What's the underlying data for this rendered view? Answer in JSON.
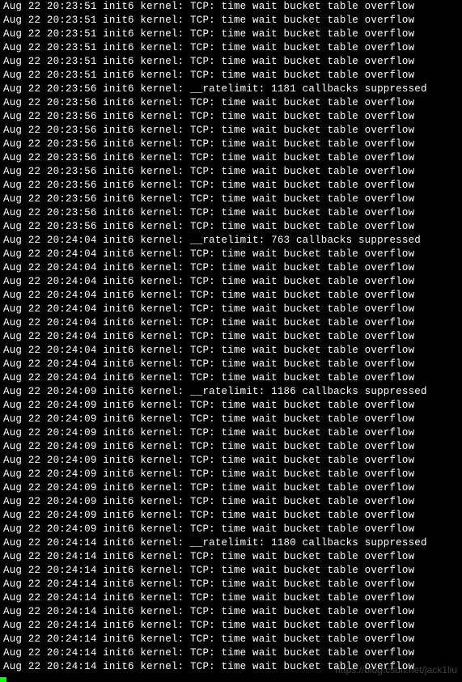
{
  "terminal": {
    "host": "init6",
    "facility": "kernel",
    "tcp_msg": "TCP: time wait bucket table overflow",
    "ratelimit_prefix": "__ratelimit:",
    "ratelimit_suffix": "callbacks suppressed",
    "lines": [
      {
        "date": "Aug 22",
        "time": "20:23:51",
        "type": "tcp"
      },
      {
        "date": "Aug 22",
        "time": "20:23:51",
        "type": "tcp"
      },
      {
        "date": "Aug 22",
        "time": "20:23:51",
        "type": "tcp"
      },
      {
        "date": "Aug 22",
        "time": "20:23:51",
        "type": "tcp"
      },
      {
        "date": "Aug 22",
        "time": "20:23:51",
        "type": "tcp"
      },
      {
        "date": "Aug 22",
        "time": "20:23:51",
        "type": "tcp"
      },
      {
        "date": "Aug 22",
        "time": "20:23:56",
        "type": "ratelimit",
        "count": 1181
      },
      {
        "date": "Aug 22",
        "time": "20:23:56",
        "type": "tcp"
      },
      {
        "date": "Aug 22",
        "time": "20:23:56",
        "type": "tcp"
      },
      {
        "date": "Aug 22",
        "time": "20:23:56",
        "type": "tcp"
      },
      {
        "date": "Aug 22",
        "time": "20:23:56",
        "type": "tcp"
      },
      {
        "date": "Aug 22",
        "time": "20:23:56",
        "type": "tcp"
      },
      {
        "date": "Aug 22",
        "time": "20:23:56",
        "type": "tcp"
      },
      {
        "date": "Aug 22",
        "time": "20:23:56",
        "type": "tcp"
      },
      {
        "date": "Aug 22",
        "time": "20:23:56",
        "type": "tcp"
      },
      {
        "date": "Aug 22",
        "time": "20:23:56",
        "type": "tcp"
      },
      {
        "date": "Aug 22",
        "time": "20:23:56",
        "type": "tcp"
      },
      {
        "date": "Aug 22",
        "time": "20:24:04",
        "type": "ratelimit",
        "count": 763
      },
      {
        "date": "Aug 22",
        "time": "20:24:04",
        "type": "tcp"
      },
      {
        "date": "Aug 22",
        "time": "20:24:04",
        "type": "tcp"
      },
      {
        "date": "Aug 22",
        "time": "20:24:04",
        "type": "tcp"
      },
      {
        "date": "Aug 22",
        "time": "20:24:04",
        "type": "tcp"
      },
      {
        "date": "Aug 22",
        "time": "20:24:04",
        "type": "tcp"
      },
      {
        "date": "Aug 22",
        "time": "20:24:04",
        "type": "tcp"
      },
      {
        "date": "Aug 22",
        "time": "20:24:04",
        "type": "tcp"
      },
      {
        "date": "Aug 22",
        "time": "20:24:04",
        "type": "tcp"
      },
      {
        "date": "Aug 22",
        "time": "20:24:04",
        "type": "tcp"
      },
      {
        "date": "Aug 22",
        "time": "20:24:04",
        "type": "tcp"
      },
      {
        "date": "Aug 22",
        "time": "20:24:09",
        "type": "ratelimit",
        "count": 1186
      },
      {
        "date": "Aug 22",
        "time": "20:24:09",
        "type": "tcp"
      },
      {
        "date": "Aug 22",
        "time": "20:24:09",
        "type": "tcp"
      },
      {
        "date": "Aug 22",
        "time": "20:24:09",
        "type": "tcp"
      },
      {
        "date": "Aug 22",
        "time": "20:24:09",
        "type": "tcp"
      },
      {
        "date": "Aug 22",
        "time": "20:24:09",
        "type": "tcp"
      },
      {
        "date": "Aug 22",
        "time": "20:24:09",
        "type": "tcp"
      },
      {
        "date": "Aug 22",
        "time": "20:24:09",
        "type": "tcp"
      },
      {
        "date": "Aug 22",
        "time": "20:24:09",
        "type": "tcp"
      },
      {
        "date": "Aug 22",
        "time": "20:24:09",
        "type": "tcp"
      },
      {
        "date": "Aug 22",
        "time": "20:24:09",
        "type": "tcp"
      },
      {
        "date": "Aug 22",
        "time": "20:24:14",
        "type": "ratelimit",
        "count": 1180
      },
      {
        "date": "Aug 22",
        "time": "20:24:14",
        "type": "tcp"
      },
      {
        "date": "Aug 22",
        "time": "20:24:14",
        "type": "tcp"
      },
      {
        "date": "Aug 22",
        "time": "20:24:14",
        "type": "tcp"
      },
      {
        "date": "Aug 22",
        "time": "20:24:14",
        "type": "tcp"
      },
      {
        "date": "Aug 22",
        "time": "20:24:14",
        "type": "tcp"
      },
      {
        "date": "Aug 22",
        "time": "20:24:14",
        "type": "tcp"
      },
      {
        "date": "Aug 22",
        "time": "20:24:14",
        "type": "tcp"
      },
      {
        "date": "Aug 22",
        "time": "20:24:14",
        "type": "tcp"
      },
      {
        "date": "Aug 22",
        "time": "20:24:14",
        "type": "tcp"
      }
    ]
  },
  "watermark": "https://blog.csdn.net/jack1liu"
}
